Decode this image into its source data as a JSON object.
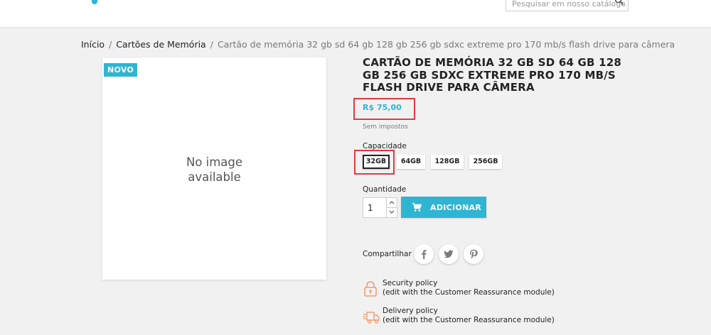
{
  "header": {
    "search_placeholder": "Pesquisar em nosso catálogo"
  },
  "breadcrumb": {
    "items": [
      "Início",
      "Cartões de Memória"
    ],
    "current": "Cartão de memória 32 gb sd 64 gb 128 gb 256 gb sdxc extreme pro 170 mb/s flash drive para câmera"
  },
  "product": {
    "badge": "NOVO",
    "no_image_text": "No image available",
    "title": "Cartão de memória 32 gb sd 64 gb 128 gb 256 gb sdxc extreme pro 170 mb/s flash drive para câmera",
    "price": "R$ 75,00",
    "tax_note": "Sem impostos",
    "capacity_label": "Capacidade",
    "capacity_options": [
      "32GB",
      "64GB",
      "128GB",
      "256GB"
    ],
    "capacity_selected": "32GB",
    "quantity_label": "Quantidade",
    "quantity_value": "1",
    "add_to_cart_label": "ADICIONAR",
    "share_label": "Compartilhar"
  },
  "reassurance": [
    {
      "title": "Security policy",
      "subtitle": "(edit with the Customer Reassurance module)",
      "icon": "lock-icon"
    },
    {
      "title": "Delivery policy",
      "subtitle": "(edit with the Customer Reassurance module)",
      "icon": "truck-icon"
    }
  ],
  "colors": {
    "accent": "#2fb5d2",
    "highlight": "#e23b3b",
    "background": "#f1f1f1"
  }
}
